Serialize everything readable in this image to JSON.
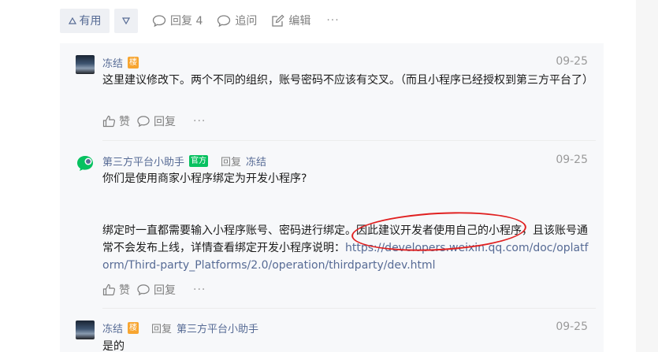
{
  "action_bar": {
    "useful_label": "有用",
    "reply_label": "回复 4",
    "follow_label": "追问",
    "edit_label": "编辑",
    "more_label": "···"
  },
  "replies": [
    {
      "author": "冻结",
      "badge": "楼",
      "date": "09-25",
      "text": "这里建议修改下。两个不同的组织，账号密码不应该有交叉。（而且小程序已经授权到第三方平台了）",
      "like_label": "赞",
      "reply_label": "回复",
      "more_label": "···"
    },
    {
      "author": "第三方平台小助手",
      "badge": "官方",
      "reply_word": "回复",
      "reply_to": "冻结",
      "date": "09-25",
      "text_line1": "你们是使用商家小程序绑定为开发小程序?",
      "text_line2": "绑定时一直都需要输入小程序账号、密码进行绑定。因此建议开发者使用自己的小程序，且该账号通常不会发布上线，详情查看绑定开发小程序说明：",
      "link": "https://developers.weixin.qq.com/doc/oplatform/Third-party_Platforms/2.0/operation/thirdparty/dev.html",
      "like_label": "赞",
      "reply_label": "回复",
      "more_label": "···"
    },
    {
      "author": "冻结",
      "badge": "楼",
      "reply_word": "回复",
      "reply_to": "第三方平台小助手",
      "date": "09-25",
      "text": "是的"
    }
  ],
  "colors": {
    "link": "#576b95",
    "official_badge": "#07c160",
    "owner_badge": "#f7a530",
    "highlight_circle": "#e02020"
  }
}
